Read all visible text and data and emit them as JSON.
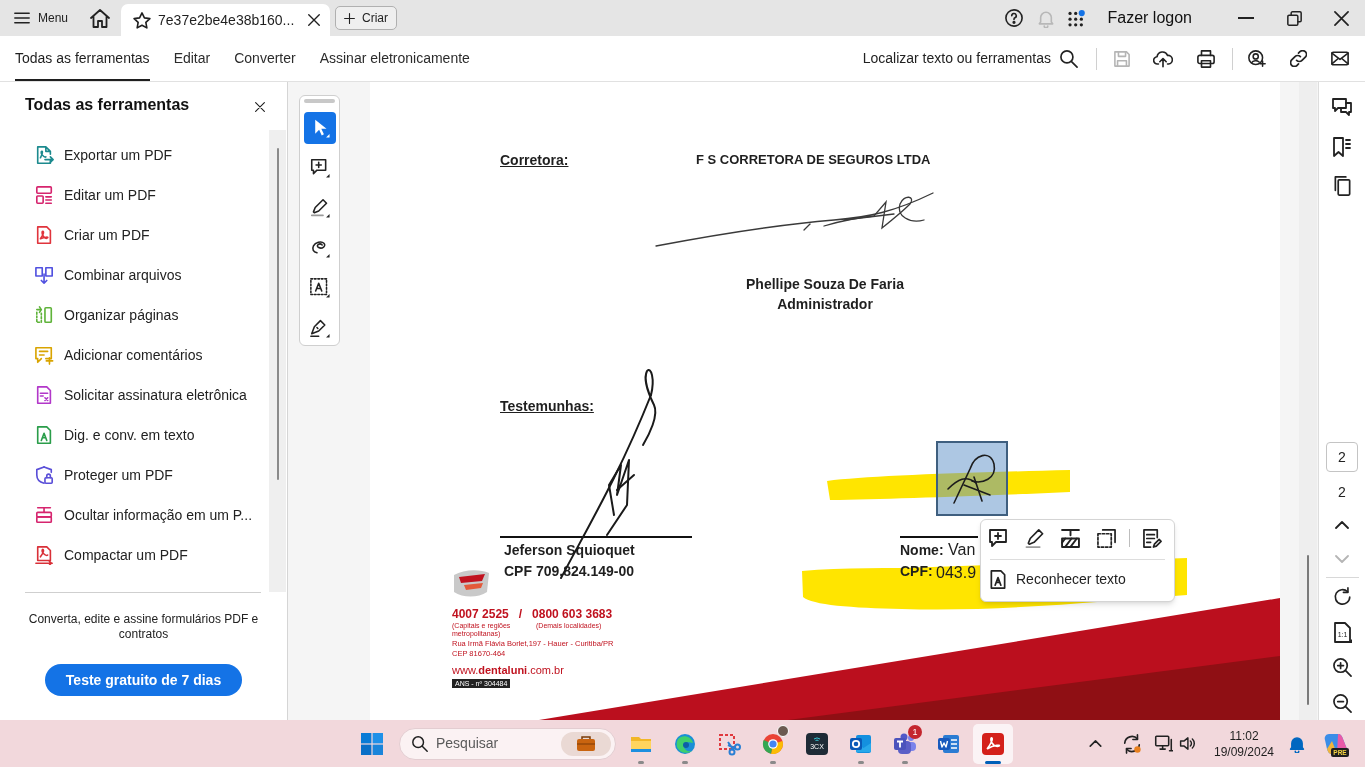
{
  "app_bar": {
    "menu_label": "Menu",
    "document_tabs": [
      {
        "label": "7e37e2be4e38b160...",
        "selected": true
      }
    ],
    "create_button": "Criar",
    "notifications": {
      "disabled": true
    },
    "sign_in": "Fazer logon"
  },
  "toolbar": {
    "tabs": [
      {
        "label": "Todas as ferramentas",
        "selected": true
      },
      {
        "label": "Editar",
        "selected": false
      },
      {
        "label": "Converter",
        "selected": false
      },
      {
        "label": "Assinar eletronicamente",
        "selected": false
      }
    ],
    "search_label": "Localizar texto ou ferramentas",
    "save": {
      "disabled": true
    }
  },
  "tools_panel": {
    "title": "Todas as ferramentas",
    "items": [
      {
        "label": "Exportar um PDF",
        "color": "#1c8a8e"
      },
      {
        "label": "Editar um PDF",
        "color": "#d6246e"
      },
      {
        "label": "Criar um PDF",
        "color": "#e0343c"
      },
      {
        "label": "Combinar arquivos",
        "color": "#5151e0"
      },
      {
        "label": "Organizar páginas",
        "color": "#5fb33a"
      },
      {
        "label": "Adicionar comentários",
        "color": "#d9a400"
      },
      {
        "label": "Solicitar assinatura eletrônica",
        "color": "#b237c9"
      },
      {
        "label": "Dig. e conv. em texto",
        "color": "#2a9d4a"
      },
      {
        "label": "Proteger um PDF",
        "color": "#5a4fd8"
      },
      {
        "label": "Ocultar informação em um P...",
        "color": "#d6246e"
      },
      {
        "label": "Compactar um PDF",
        "color": "#d93038"
      }
    ],
    "promo_text": "Converta, edite e assine formulários PDF e contratos",
    "trial_button": "Teste gratuito de 7 dias"
  },
  "quick_tools": [
    {
      "selected": true
    },
    {
      "selected": false
    },
    {
      "selected": false
    },
    {
      "selected": false
    },
    {
      "selected": false
    },
    {
      "selected": false
    }
  ],
  "document": {
    "broker_label": "Corretora:",
    "broker_name": "F S CORRETORA DE SEGUROS LTDA",
    "signatory_name": "Phellipe Souza De Faria",
    "signatory_role": "Administrador",
    "witnesses_label": "Testemunhas:",
    "witness_1": {
      "name": "Jeferson Squioquet",
      "cpf": "CPF 709.824.149-00"
    },
    "witness_2": {
      "name_label": "Nome:",
      "name_value": "Van",
      "cpf_label": "CPF:",
      "cpf_value": "043.9"
    },
    "footer": {
      "phone_1": "4007 2525",
      "separator": "/",
      "phone_2": "0800 603 3683",
      "phone_1_note": "(Capitais e regiões metropolitanas)",
      "phone_2_note": "(Demais localidades)",
      "address_1": "Rua Irmã Flávia Borlet,197 - Hauer - Curitiba/PR",
      "address_2": "CEP 81670-464",
      "website": "www.**dentaluni**.com.br",
      "registration": "ANS - nº 304484"
    }
  },
  "selection_menu": {
    "action": "Reconhecer texto"
  },
  "page_nav": {
    "current_page": "2",
    "page_count": "2",
    "previous_disabled": false,
    "next_disabled": true,
    "fit_label": "1:1"
  },
  "taskbar": {
    "search_placeholder": "Pesquisar",
    "apps": [
      {
        "running": true,
        "selected": false
      },
      {
        "running": true,
        "selected": false
      },
      {
        "running": false,
        "selected": false
      },
      {
        "running": true,
        "selected": false
      },
      {
        "running": false,
        "selected": false,
        "label": "3CX"
      },
      {
        "running": true,
        "selected": false
      },
      {
        "running": true,
        "selected": false,
        "badge": "1"
      },
      {
        "running": false,
        "selected": false
      },
      {
        "running": true,
        "selected": true
      }
    ],
    "time": "11:02",
    "date": "19/09/2024",
    "assistant_badge": "PRE"
  }
}
